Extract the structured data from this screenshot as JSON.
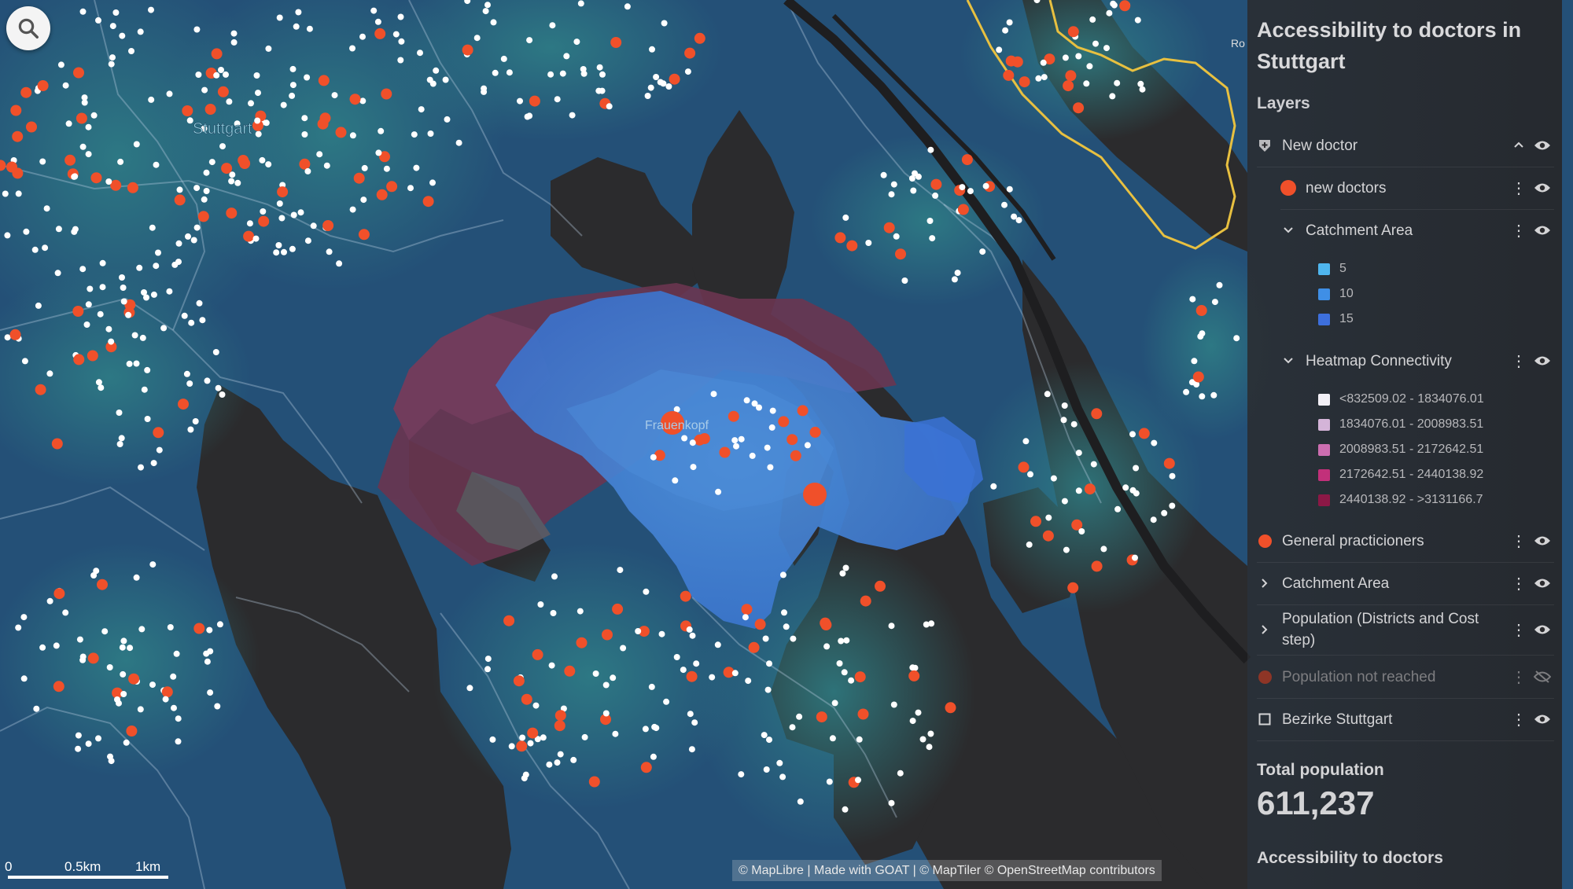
{
  "map": {
    "place_labels": [
      {
        "text": "Stuttgart"
      },
      {
        "text": "Frauenkopf"
      },
      {
        "text": "Ro"
      }
    ],
    "search_icon": "search-icon",
    "scale": {
      "labels": [
        "0",
        "0.5km",
        "1km"
      ]
    },
    "attribution": "© MapLibre | Made with GOAT | © MapTiler © OpenStreetMap contributors",
    "colors": {
      "doctor_point": "#f0502a",
      "population_point": "#ffffff",
      "boundary": "#e8c040"
    }
  },
  "panel": {
    "title": "Accessibility to doctors in Stuttgart",
    "layers_heading": "Layers",
    "layers": [
      {
        "label": "New doctor",
        "icon": "marker-shield-icon",
        "expanded": true
      },
      {
        "label": "new doctors",
        "icon": "dot-icon",
        "color": "#f0502a"
      },
      {
        "label": "Catchment Area",
        "icon": "chevron-down-icon",
        "expanded": true,
        "legend": [
          {
            "label": "5",
            "color": "#4fb6ee"
          },
          {
            "label": "10",
            "color": "#3f8fe6"
          },
          {
            "label": "15",
            "color": "#3d6fdc"
          }
        ]
      },
      {
        "label": "Heatmap Connectivity",
        "icon": "chevron-down-icon",
        "expanded": true,
        "legend": [
          {
            "label": "<832509.02 - 1834076.01",
            "color": "#f2f0f6"
          },
          {
            "label": "1834076.01 - 2008983.51",
            "color": "#d4b4d8"
          },
          {
            "label": "2008983.51 - 2172642.51",
            "color": "#cc6eb0"
          },
          {
            "label": "2172642.51 - 2440138.92",
            "color": "#c2307a"
          },
          {
            "label": "2440138.92 - >3131166.7",
            "color": "#8c1846"
          }
        ]
      },
      {
        "label": "General practicioners",
        "icon": "dot-icon",
        "color": "#f0502a"
      },
      {
        "label": "Catchment Area",
        "icon": "chevron-right-icon",
        "expanded": false
      },
      {
        "label": "Population (Districts and Cost step)",
        "icon": "chevron-right-icon",
        "expanded": false
      },
      {
        "label": "Population not reached",
        "icon": "dot-icon",
        "color": "#c8402a",
        "hidden": true
      },
      {
        "label": "Bezirke Stuttgart",
        "icon": "square-outline-icon"
      }
    ],
    "total_population_label": "Total population",
    "total_population_value": "611,237",
    "accessibility_label": "Accessibility to doctors"
  }
}
